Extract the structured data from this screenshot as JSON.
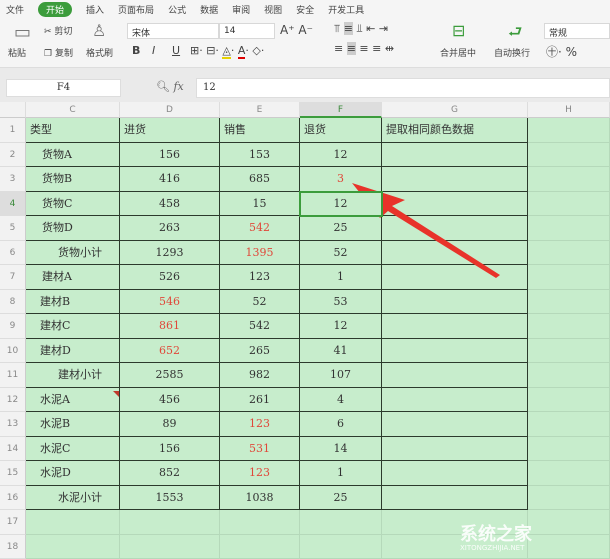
{
  "menu": {
    "items": [
      "文件",
      "开始",
      "插入",
      "页面布局",
      "公式",
      "数据",
      "审阅",
      "视图",
      "安全",
      "开发工具"
    ],
    "active": "开始"
  },
  "ribbon": {
    "paste": "粘贴",
    "cut": "剪切",
    "copy": "复制",
    "format_painter": "格式刷",
    "font": "宋体",
    "size": "14",
    "bold": "B",
    "italic": "I",
    "underline": "U",
    "merge": "合并居中",
    "wrap": "自动换行",
    "number_format": "常规",
    "percent": "%"
  },
  "formula": {
    "cell_ref": "F4",
    "fx": "fx",
    "value": "12"
  },
  "columns": [
    "C",
    "D",
    "E",
    "F",
    "G",
    "H"
  ],
  "selected_column": "F",
  "rows": [
    [
      "类型",
      "进货",
      "销售",
      "退货",
      "提取相同颜色数据"
    ],
    [
      "货物A",
      "156",
      "153",
      "12",
      ""
    ],
    [
      "货物B",
      "416",
      "685",
      "3",
      ""
    ],
    [
      "货物C",
      "458",
      "15",
      "12",
      ""
    ],
    [
      "货物D",
      "263",
      "542",
      "25",
      ""
    ],
    [
      "货物小计",
      "1293",
      "1395",
      "52",
      ""
    ],
    [
      "建材A",
      "526",
      "123",
      "1",
      ""
    ],
    [
      "建材B",
      "546",
      "52",
      "53",
      ""
    ],
    [
      "建材C",
      "861",
      "542",
      "12",
      ""
    ],
    [
      "建材D",
      "652",
      "265",
      "41",
      ""
    ],
    [
      "建材小计",
      "2585",
      "982",
      "107",
      ""
    ],
    [
      "水泥A",
      "456",
      "261",
      "4",
      ""
    ],
    [
      "水泥B",
      "89",
      "123",
      "6",
      ""
    ],
    [
      "水泥C",
      "156",
      "531",
      "14",
      ""
    ],
    [
      "水泥D",
      "852",
      "123",
      "1",
      ""
    ],
    [
      "水泥小计",
      "1553",
      "1038",
      "25",
      ""
    ]
  ],
  "extra_rows": [
    "17",
    "18"
  ],
  "selected_row": 4,
  "red_cells": [
    [
      3,
      3
    ],
    [
      5,
      2
    ],
    [
      6,
      2
    ],
    [
      8,
      1
    ],
    [
      9,
      1
    ],
    [
      10,
      1
    ],
    [
      13,
      2
    ],
    [
      14,
      2
    ],
    [
      15,
      2
    ]
  ],
  "colors": {
    "cell_bg": "#c7edcc",
    "red": "#e0483a",
    "accent": "#3c9c3c",
    "arrow": "#e8332a"
  },
  "watermark": {
    "text": "系统之家",
    "sub": "XITONGZHIJIA.NET"
  }
}
